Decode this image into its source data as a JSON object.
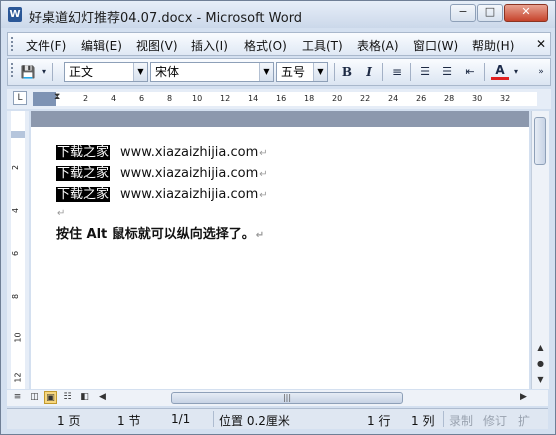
{
  "window": {
    "title": "好桌道幻灯推荐04.07.docx - Microsoft Word",
    "controls": {
      "minimize": "−",
      "maximize": "□",
      "close": "✕"
    }
  },
  "menu": {
    "items": [
      "文件(F)",
      "编辑(E)",
      "视图(V)",
      "插入(I)",
      "格式(O)",
      "工具(T)",
      "表格(A)",
      "窗口(W)",
      "帮助(H)"
    ]
  },
  "toolbar": {
    "style_value": "正文",
    "font_value": "宋体",
    "size_value": "五号",
    "bold": "B",
    "italic": "I",
    "font_color_label": "A"
  },
  "ruler": {
    "ticks": [
      "2",
      "4",
      "6",
      "8",
      "10",
      "12",
      "14",
      "16",
      "18",
      "20",
      "22",
      "24",
      "26",
      "28",
      "30",
      "32"
    ],
    "corner_label": "L"
  },
  "vruler": {
    "numbers": [
      "2",
      "4",
      "6",
      "8",
      "10",
      "12"
    ]
  },
  "document": {
    "lines": [
      {
        "highlight": "下载之家",
        "text": "www.xiazaizhijia.com"
      },
      {
        "highlight": "下载之家",
        "text": "www.xiazaizhijia.com"
      },
      {
        "highlight": "下载之家",
        "text": "www.xiazaizhijia.com"
      }
    ],
    "paragraph_mark": "↵",
    "bold_line": "按住 Alt 鼠标就可以纵向选择了。"
  },
  "statusbar": {
    "page": "1 页",
    "section": "1 节",
    "pages": "1/1",
    "position": "位置 0.2厘米",
    "line": "1 行",
    "col": "1 列",
    "rec": "录制",
    "trk": "修订",
    "ext": "扩"
  }
}
